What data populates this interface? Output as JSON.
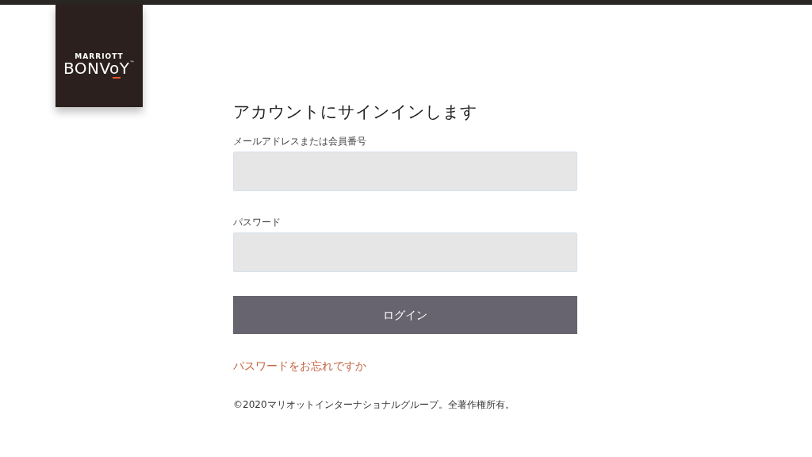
{
  "logo": {
    "line_1": "MARRIOTT",
    "line_2": "BONVoY",
    "trademark": "™"
  },
  "heading": "アカウントにサインインします",
  "fields": [
    {
      "label": "メールアドレスまたは会員番号"
    },
    {
      "label": "パスワード"
    }
  ],
  "login_button": "ログイン",
  "forgot_link": "パスワードをお忘れですか",
  "footer": "©2020マリオットインターナショナルグループ。全著作権所有。"
}
